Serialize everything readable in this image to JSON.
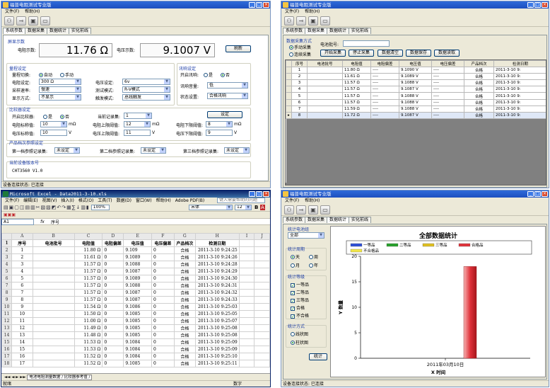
{
  "window1": {
    "title": "福普电阻测试专业版",
    "menu": [
      "文件(F)",
      "帮助(H)"
    ],
    "tabs": [
      "系统参数",
      "数据采集",
      "数据统计",
      "实化前线"
    ],
    "display": {
      "section": "屏显示数",
      "res_label": "电阻示数:",
      "res_value": "11.76 Ω",
      "volt_label": "电压示数:",
      "volt_value": "9.1007 V",
      "refresh": "刷新"
    },
    "range": {
      "section": "量程设定",
      "switch_label": "量程切换:",
      "auto": "自动",
      "manual": "手动",
      "res_set_label": "电阻设定:",
      "res_set": "300 Ω",
      "volt_set_label": "电压设定:",
      "volt_set": "6v",
      "sample_label": "采样速率:",
      "sample": "慢速",
      "mode_label": "测试模式:",
      "mode": "R-V模式",
      "disp_label": "显示方式:",
      "disp": "不显示",
      "trigger_label": "触发模式:",
      "trigger": "总线触发"
    },
    "alarm": {
      "section": "讯响设定",
      "enable_label": "开启讯响:",
      "yes": "是",
      "no": "否",
      "vol_label": "讯响音量:",
      "vol": "低",
      "state_label": "状态设置:",
      "state": "合格讯响"
    },
    "compare": {
      "section": "比较器设定",
      "enable_label": "开启比较器:",
      "yes": "是",
      "no": "否",
      "record_label": "当前记录集:",
      "record": "1",
      "set_btn": "设定",
      "res_nominal_label": "电阻标称值:",
      "res_nominal": "10",
      "res_nominal_unit": "mΩ",
      "res_upper_label": "电阻上限阈值:",
      "res_upper": "12",
      "res_upper_unit": "mΩ",
      "res_lower_label": "电阻下限阈值:",
      "res_lower": "8",
      "res_lower_unit": "mΩ",
      "volt_nominal_label": "电压标称值:",
      "volt_nominal": "10",
      "volt_nominal_unit": "V",
      "volt_upper_label": "电压上限阈值:",
      "volt_upper": "11",
      "volt_upper_unit": "V",
      "volt_lower_label": "电压下限阈值:",
      "volt_lower": "9",
      "volt_lower_unit": "V"
    },
    "grade": {
      "section": "产品档次参照设定",
      "g1_label": "第一档参照记录集:",
      "g1": "未设定",
      "g2_label": "第二档参照记录集:",
      "g2": "未设定",
      "g3_label": "第三档参照记录集:",
      "g3": "未设定"
    },
    "version": {
      "section": "当前设备版本号",
      "value": "CHT3560 V1.0"
    },
    "status": "设备连接状态: 已连接"
  },
  "window2": {
    "title": "福普电阻测试专业版",
    "menu": [
      "文件(F)",
      "帮助(H)"
    ],
    "tabs": [
      "系统参数",
      "数据采集",
      "数据统计",
      "实化前线"
    ],
    "mode_section": "数据采集方式",
    "manual": "手动采集",
    "continuous": "连续采集",
    "cell_label": "电池批号:",
    "buttons": [
      "开始采集",
      "停止采集",
      "数据清空",
      "数据保存",
      "数据读取"
    ],
    "columns": [
      "序号",
      "电池批号",
      "电阻值",
      "电阻偏差",
      "电压值",
      "电压偏差",
      "产品档次",
      "检测日期"
    ],
    "rows": [
      [
        "1",
        "",
        "11.80 Ω",
        "----",
        "9.1090 V",
        "----",
        "合格",
        "2011-3-10 9:"
      ],
      [
        "2",
        "",
        "11.61 Ω",
        "----",
        "9.1089 V",
        "----",
        "合格",
        "2011-3-10 9:"
      ],
      [
        "3",
        "",
        "11.57 Ω",
        "----",
        "9.1088 V",
        "----",
        "合格",
        "2011-3-10 9:"
      ],
      [
        "4",
        "",
        "11.57 Ω",
        "----",
        "9.1087 V",
        "----",
        "合格",
        "2011-3-10 9:"
      ],
      [
        "5",
        "",
        "11.57 Ω",
        "----",
        "9.1088 V",
        "----",
        "合格",
        "2011-3-10 9:"
      ],
      [
        "6",
        "",
        "11.57 Ω",
        "----",
        "9.1088 V",
        "----",
        "合格",
        "2011-3-10 9:"
      ],
      [
        "7",
        "",
        "11.59 Ω",
        "----",
        "9.1088 V",
        "----",
        "合格",
        "2011-3-10 9:"
      ],
      [
        "8",
        "",
        "11.72 Ω",
        "----",
        "9.1087 V",
        "----",
        "合格",
        "2011-3-10 9:"
      ]
    ]
  },
  "excel": {
    "title": "Microsoft Excel - Data2011-3-10.xls",
    "menu": [
      "文件(F)",
      "编辑(E)",
      "视图(V)",
      "插入(I)",
      "格式(O)",
      "工具(T)",
      "数据(D)",
      "窗口(W)",
      "帮助(H)",
      "Adobe PDF(B)"
    ],
    "help_placeholder": "键入需要帮助的问题",
    "font": "宋体",
    "font_size": "12",
    "zoom": "100%",
    "name_box": "A1",
    "formula": "序号",
    "col_letters": [
      "A",
      "B",
      "C",
      "D",
      "E",
      "F",
      "G",
      "H",
      "I",
      "J"
    ],
    "headers": [
      "序号",
      "电池批号",
      "电阻值",
      "电阻偏差",
      "电压值",
      "电压偏差",
      "产品档次",
      "检测日期"
    ],
    "rows": [
      [
        "1",
        "",
        "11.80 Ω",
        "0",
        "9.109",
        "0",
        "合格",
        "2011-3-10 9:24:25"
      ],
      [
        "2",
        "",
        "11.61 Ω",
        "0",
        "9.1089",
        "0",
        "合格",
        "2011-3-10 9:24:26"
      ],
      [
        "3",
        "",
        "11.57 Ω",
        "0",
        "9.1088",
        "0",
        "合格",
        "2011-3-10 9:24:28"
      ],
      [
        "4",
        "",
        "11.57 Ω",
        "0",
        "9.1087",
        "0",
        "合格",
        "2011-3-10 9:24:29"
      ],
      [
        "5",
        "",
        "11.57 Ω",
        "0",
        "9.1089",
        "0",
        "合格",
        "2011-3-10 9:24:30"
      ],
      [
        "6",
        "",
        "11.57 Ω",
        "0",
        "9.1088",
        "0",
        "合格",
        "2011-3-10 9:24:31"
      ],
      [
        "7",
        "",
        "11.57 Ω",
        "0",
        "9.1087",
        "0",
        "合格",
        "2011-3-10 9:24:32"
      ],
      [
        "8",
        "",
        "11.57 Ω",
        "0",
        "9.1087",
        "0",
        "合格",
        "2011-3-10 9:24:33"
      ],
      [
        "9",
        "",
        "11.54 Ω",
        "0",
        "9.1086",
        "0",
        "合格",
        "2011-3-10 9:25:03"
      ],
      [
        "10",
        "",
        "11.50 Ω",
        "0",
        "9.1085",
        "0",
        "合格",
        "2011-3-10 9:25:05"
      ],
      [
        "11",
        "",
        "11.00 Ω",
        "0",
        "9.1085",
        "0",
        "合格",
        "2011-3-10 9:25:07"
      ],
      [
        "12",
        "",
        "11.49 Ω",
        "0",
        "9.1085",
        "0",
        "合格",
        "2011-3-10 9:25:08"
      ],
      [
        "13",
        "",
        "11.48 Ω",
        "0",
        "9.1085",
        "0",
        "合格",
        "2011-3-10 9:25:08"
      ],
      [
        "14",
        "",
        "11.53 Ω",
        "0",
        "9.1084",
        "0",
        "合格",
        "2011-3-10 9:25:09"
      ],
      [
        "15",
        "",
        "11.53 Ω",
        "0",
        "9.1084",
        "0",
        "合格",
        "2011-3-10 9:25:09"
      ],
      [
        "16",
        "",
        "11.52 Ω",
        "0",
        "9.1084",
        "0",
        "合格",
        "2011-3-10 9:25:10"
      ],
      [
        "17",
        "",
        "11.52 Ω",
        "0",
        "9.1085",
        "0",
        "合格",
        "2011-3-10 9:25:11"
      ]
    ],
    "sheet_tab": "电池电阻测量数据 / 比较器参考值 /",
    "status_ready": "就绪",
    "status_num": "数字"
  },
  "window3": {
    "title": "福普电阻测试专业版",
    "menu": [
      "文件(F)",
      "帮助(H)"
    ],
    "tabs": [
      "系统参数",
      "数据采集",
      "数据统计",
      "实化前线"
    ],
    "stat_range_section": "统计电池组",
    "stat_range": "全部",
    "period_section": "统计周期",
    "period": [
      "天",
      "周",
      "月",
      "年"
    ],
    "grade_section": "统计等级",
    "grades": [
      "一等品",
      "二等品",
      "三等品",
      "合格",
      "不合格"
    ],
    "method_section": "统计方式",
    "methods": [
      "线状图",
      "柱状图"
    ],
    "stat_btn": "统计",
    "status": "设备连接状态: 已连接"
  },
  "chart_data": {
    "type": "bar",
    "title": "全部数据统计",
    "xlabel": "X 时间",
    "ylabel": "Y 数量",
    "categories": [
      "2011年03月10日"
    ],
    "legend": [
      "一等品",
      "二等品",
      "三等品",
      "合格品",
      "不合格品"
    ],
    "legend_colors": [
      "#2f4fd6",
      "#27a12b",
      "#e0c020",
      "#e0323a",
      "#f1e64a"
    ],
    "series": [
      {
        "name": "合格品",
        "values": [
          18
        ]
      }
    ],
    "yticks": [
      0,
      5,
      10,
      15,
      20
    ],
    "ylim": [
      0,
      20
    ],
    "legend_position": "top"
  }
}
